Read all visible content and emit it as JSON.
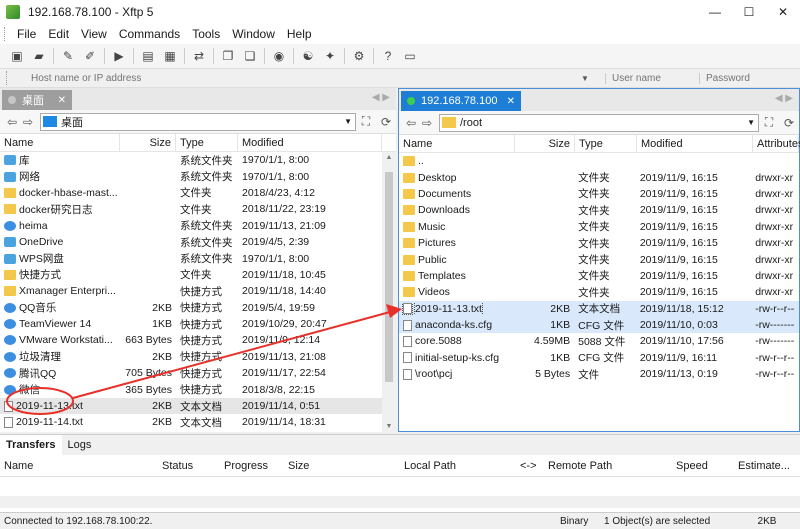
{
  "window": {
    "title": "192.168.78.100 - Xftp 5",
    "min": "—",
    "max": "☐",
    "close": "✕"
  },
  "menu": [
    "File",
    "Edit",
    "View",
    "Commands",
    "Tools",
    "Window",
    "Help"
  ],
  "address_bar": {
    "host_placeholder": "Host name or IP address",
    "user_placeholder": "User name",
    "password_placeholder": "Password"
  },
  "left": {
    "tab": "桌面",
    "path": "桌面",
    "columns": [
      "Name",
      "Size",
      "Type",
      "Modified"
    ],
    "rows": [
      {
        "name": "库",
        "size": "",
        "type": "系统文件夹",
        "modified": "1970/1/1, 8:00",
        "icon": "sys"
      },
      {
        "name": "网络",
        "size": "",
        "type": "系统文件夹",
        "modified": "1970/1/1, 8:00",
        "icon": "sys"
      },
      {
        "name": "docker-hbase-mast...",
        "size": "",
        "type": "文件夹",
        "modified": "2018/4/23, 4:12",
        "icon": "folder"
      },
      {
        "name": "docker研究日志",
        "size": "",
        "type": "文件夹",
        "modified": "2018/11/22, 23:19",
        "icon": "folder"
      },
      {
        "name": "heima",
        "size": "",
        "type": "系统文件夹",
        "modified": "2019/11/13, 21:09",
        "icon": "app"
      },
      {
        "name": "OneDrive",
        "size": "",
        "type": "系统文件夹",
        "modified": "2019/4/5, 2:39",
        "icon": "sys"
      },
      {
        "name": "WPS网盘",
        "size": "",
        "type": "系统文件夹",
        "modified": "1970/1/1, 8:00",
        "icon": "sys"
      },
      {
        "name": "快捷方式",
        "size": "",
        "type": "文件夹",
        "modified": "2019/11/18, 10:45",
        "icon": "folder"
      },
      {
        "name": "Xmanager Enterpri...",
        "size": "",
        "type": "快捷方式",
        "modified": "2019/11/18, 14:40",
        "icon": "folder"
      },
      {
        "name": "QQ音乐",
        "size": "2KB",
        "type": "快捷方式",
        "modified": "2019/5/4, 19:59",
        "icon": "app"
      },
      {
        "name": "TeamViewer 14",
        "size": "1KB",
        "type": "快捷方式",
        "modified": "2019/10/29, 20:47",
        "icon": "app"
      },
      {
        "name": "VMware Workstati...",
        "size": "663 Bytes",
        "type": "快捷方式",
        "modified": "2019/11/9, 12:14",
        "icon": "app"
      },
      {
        "name": "垃圾清理",
        "size": "2KB",
        "type": "快捷方式",
        "modified": "2019/11/13, 21:08",
        "icon": "app"
      },
      {
        "name": "腾讯QQ",
        "size": "705 Bytes",
        "type": "快捷方式",
        "modified": "2019/11/17, 22:54",
        "icon": "app"
      },
      {
        "name": "微信",
        "size": "365 Bytes",
        "type": "快捷方式",
        "modified": "2018/3/8, 22:15",
        "icon": "app"
      },
      {
        "name": "2019-11-13.txt",
        "size": "2KB",
        "type": "文本文档",
        "modified": "2019/11/14, 0:51",
        "icon": "file"
      },
      {
        "name": "2019-11-14.txt",
        "size": "2KB",
        "type": "文本文档",
        "modified": "2019/11/14, 18:31",
        "icon": "file"
      }
    ]
  },
  "right": {
    "tab": "192.168.78.100",
    "path": "/root",
    "columns": [
      "Name",
      "Size",
      "Type",
      "Modified",
      "Attributes"
    ],
    "rows": [
      {
        "name": "..",
        "size": "",
        "type": "",
        "modified": "",
        "attr": "",
        "icon": "folder"
      },
      {
        "name": "Desktop",
        "size": "",
        "type": "文件夹",
        "modified": "2019/11/9, 16:15",
        "attr": "drwxr-xr",
        "icon": "folder"
      },
      {
        "name": "Documents",
        "size": "",
        "type": "文件夹",
        "modified": "2019/11/9, 16:15",
        "attr": "drwxr-xr",
        "icon": "folder"
      },
      {
        "name": "Downloads",
        "size": "",
        "type": "文件夹",
        "modified": "2019/11/9, 16:15",
        "attr": "drwxr-xr",
        "icon": "folder"
      },
      {
        "name": "Music",
        "size": "",
        "type": "文件夹",
        "modified": "2019/11/9, 16:15",
        "attr": "drwxr-xr",
        "icon": "folder"
      },
      {
        "name": "Pictures",
        "size": "",
        "type": "文件夹",
        "modified": "2019/11/9, 16:15",
        "attr": "drwxr-xr",
        "icon": "folder"
      },
      {
        "name": "Public",
        "size": "",
        "type": "文件夹",
        "modified": "2019/11/9, 16:15",
        "attr": "drwxr-xr",
        "icon": "folder"
      },
      {
        "name": "Templates",
        "size": "",
        "type": "文件夹",
        "modified": "2019/11/9, 16:15",
        "attr": "drwxr-xr",
        "icon": "folder"
      },
      {
        "name": "Videos",
        "size": "",
        "type": "文件夹",
        "modified": "2019/11/9, 16:15",
        "attr": "drwxr-xr",
        "icon": "folder"
      },
      {
        "name": "2019-11-13.txt",
        "size": "2KB",
        "type": "文本文档",
        "modified": "2019/11/18, 15:12",
        "attr": "-rw-r--r--",
        "icon": "file"
      },
      {
        "name": "anaconda-ks.cfg",
        "size": "1KB",
        "type": "CFG 文件",
        "modified": "2019/11/10, 0:03",
        "attr": "-rw-------",
        "icon": "file"
      },
      {
        "name": "core.5088",
        "size": "4.59MB",
        "type": "5088 文件",
        "modified": "2019/11/10, 17:56",
        "attr": "-rw-------",
        "icon": "file"
      },
      {
        "name": "initial-setup-ks.cfg",
        "size": "1KB",
        "type": "CFG 文件",
        "modified": "2019/11/9, 16:11",
        "attr": "-rw-r--r--",
        "icon": "file"
      },
      {
        "name": "\\root\\pcj",
        "size": "5 Bytes",
        "type": "文件",
        "modified": "2019/11/13, 0:19",
        "attr": "-rw-r--r--",
        "icon": "file"
      }
    ]
  },
  "transfers": {
    "tabs": [
      "Transfers",
      "Logs"
    ],
    "columns": [
      "Name",
      "Status",
      "Progress",
      "Size",
      "Local Path",
      "<->",
      "Remote Path",
      "Speed",
      "Estimate..."
    ]
  },
  "status": {
    "connection": "Connected to 192.168.78.100:22.",
    "mode": "Binary",
    "selection": "1 Object(s) are selected",
    "size": "2KB"
  },
  "colors": {
    "accent_tab": "#1e7ed6",
    "annotation": "#e8302a"
  }
}
